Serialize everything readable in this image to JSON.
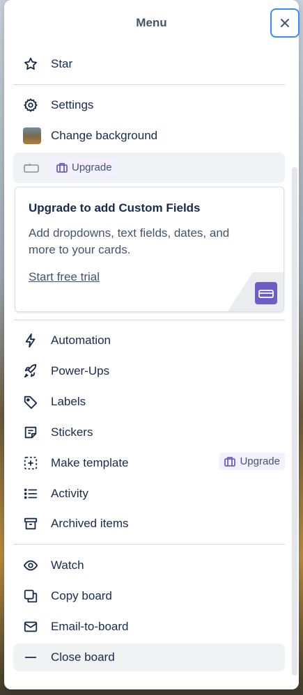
{
  "menu": {
    "title": "Menu",
    "items_top": [
      {
        "id": "star",
        "label": "Star",
        "icon": "star-icon"
      }
    ],
    "items_settings": [
      {
        "id": "settings",
        "label": "Settings",
        "icon": "gear-icon"
      },
      {
        "id": "change-background",
        "label": "Change background",
        "icon": "background-thumbnail"
      }
    ],
    "custom_fields_row": {
      "badge": "Upgrade"
    },
    "upsell": {
      "title": "Upgrade to add Custom Fields",
      "description": "Add dropdowns, text fields, dates, and more to your cards.",
      "cta": "Start free trial"
    },
    "items_tools": [
      {
        "id": "automation",
        "label": "Automation",
        "icon": "lightning-icon"
      },
      {
        "id": "power-ups",
        "label": "Power-Ups",
        "icon": "rocket-icon"
      },
      {
        "id": "labels",
        "label": "Labels",
        "icon": "tag-icon"
      },
      {
        "id": "stickers",
        "label": "Stickers",
        "icon": "sticker-icon"
      },
      {
        "id": "make-template",
        "label": "Make template",
        "icon": "template-icon",
        "badge": "Upgrade"
      },
      {
        "id": "activity",
        "label": "Activity",
        "icon": "list-icon"
      },
      {
        "id": "archived-items",
        "label": "Archived items",
        "icon": "archive-icon"
      }
    ],
    "items_bottom": [
      {
        "id": "watch",
        "label": "Watch",
        "icon": "eye-icon"
      },
      {
        "id": "copy-board",
        "label": "Copy board",
        "icon": "copy-icon"
      },
      {
        "id": "email-to-board",
        "label": "Email-to-board",
        "icon": "mail-icon"
      },
      {
        "id": "close-board",
        "label": "Close board",
        "icon": "minus-icon"
      }
    ]
  },
  "colors": {
    "accent": "#388bff",
    "upgrade_purple": "#6e5dc6",
    "text": "#172b4d",
    "muted": "#44546f"
  }
}
